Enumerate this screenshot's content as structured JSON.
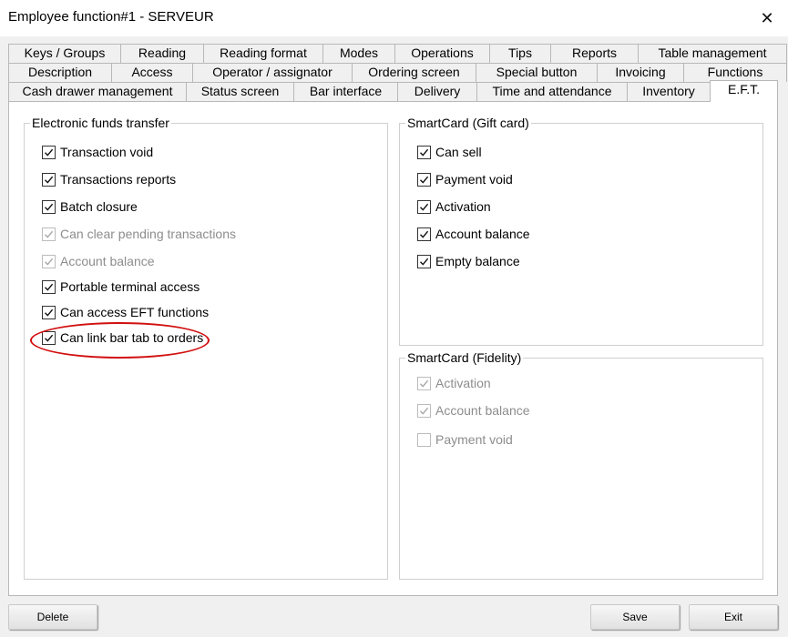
{
  "window": {
    "title": "Employee function#1 - SERVEUR",
    "close_glyph": "✕"
  },
  "tabs": {
    "row1": [
      "Keys / Groups",
      "Reading",
      "Reading format",
      "Modes",
      "Operations",
      "Tips",
      "Reports",
      "Table management"
    ],
    "row2": [
      "Description",
      "Access",
      "Operator / assignator",
      "Ordering screen",
      "Special button",
      "Invoicing",
      "Functions"
    ],
    "row3": [
      "Cash drawer management",
      "Status screen",
      "Bar interface",
      "Delivery",
      "Time and attendance",
      "Inventory",
      "E.F.T."
    ],
    "selected": "E.F.T."
  },
  "eft_group": {
    "title": "Electronic funds transfer",
    "items": [
      {
        "label": "Transaction void",
        "checked": true,
        "enabled": true
      },
      {
        "label": "Transactions reports",
        "checked": true,
        "enabled": true
      },
      {
        "label": "Batch closure",
        "checked": true,
        "enabled": true
      },
      {
        "label": "Can clear pending transactions",
        "checked": true,
        "enabled": false
      },
      {
        "label": "Account balance",
        "checked": true,
        "enabled": false
      },
      {
        "label": "Portable terminal access",
        "checked": true,
        "enabled": true
      },
      {
        "label": "Can access EFT functions",
        "checked": true,
        "enabled": true
      },
      {
        "label": "Can link bar tab to orders",
        "checked": true,
        "enabled": true
      }
    ]
  },
  "giftcard_group": {
    "title": "SmartCard (Gift card)",
    "items": [
      {
        "label": "Can sell",
        "checked": true,
        "enabled": true
      },
      {
        "label": "Payment void",
        "checked": true,
        "enabled": true
      },
      {
        "label": "Activation",
        "checked": true,
        "enabled": true
      },
      {
        "label": "Account balance",
        "checked": true,
        "enabled": true
      },
      {
        "label": "Empty balance",
        "checked": true,
        "enabled": true
      }
    ]
  },
  "fidelity_group": {
    "title": "SmartCard (Fidelity)",
    "items": [
      {
        "label": "Activation",
        "checked": true,
        "enabled": false
      },
      {
        "label": "Account balance",
        "checked": true,
        "enabled": false
      },
      {
        "label": "Payment void",
        "checked": false,
        "enabled": false
      }
    ]
  },
  "buttons": {
    "delete": "Delete",
    "save": "Save",
    "exit": "Exit"
  },
  "colors": {
    "highlight": "#d20f0f",
    "disabled_text": "#8d8d8d"
  }
}
